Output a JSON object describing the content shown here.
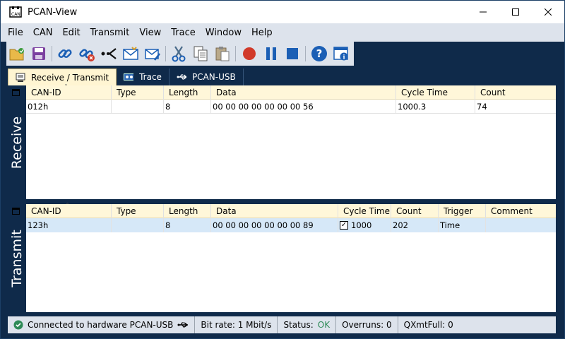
{
  "window": {
    "title": "PCAN-View"
  },
  "menu": [
    "File",
    "CAN",
    "Edit",
    "Transmit",
    "View",
    "Trace",
    "Window",
    "Help"
  ],
  "toolbar": {
    "icons": [
      "open-icon",
      "save-icon",
      "connect-icon",
      "disconnect-icon",
      "reset-icon",
      "new-message-icon",
      "edit-message-icon",
      "cut-icon",
      "copy-icon",
      "paste-icon",
      "record-icon",
      "pause-icon",
      "stop-icon",
      "help-icon",
      "about-icon"
    ]
  },
  "tabs": [
    {
      "label": "Receive / Transmit",
      "active": true
    },
    {
      "label": "Trace",
      "active": false
    },
    {
      "label": "PCAN-USB",
      "active": false
    }
  ],
  "receive": {
    "side_label": "Receive",
    "columns": [
      "CAN-ID",
      "Type",
      "Length",
      "Data",
      "Cycle Time",
      "Count"
    ],
    "rows": [
      {
        "can_id": "012h",
        "type": "",
        "length": "8",
        "data": "00 00 00 00 00 00 00 56",
        "cycle_time": "1000.3",
        "count": "74"
      }
    ]
  },
  "transmit": {
    "side_label": "Transmit",
    "columns": [
      "CAN-ID",
      "Type",
      "Length",
      "Data",
      "Cycle Time",
      "Count",
      "Trigger",
      "Comment"
    ],
    "rows": [
      {
        "can_id": "123h",
        "type": "",
        "length": "8",
        "data": "00 00 00 00 00 00 00 89",
        "cycle_checked": true,
        "cycle_time": "1000",
        "count": "202",
        "trigger": "Time",
        "comment": ""
      }
    ]
  },
  "status": {
    "connected_text": "Connected to hardware PCAN-USB",
    "bit_rate": "Bit rate: 1 Mbit/s",
    "status_label": "Status:",
    "status_value": "OK",
    "overruns": "Overruns: 0",
    "qxmtfull": "QXmtFull: 0"
  },
  "colors": {
    "accent": "#0f2a4a",
    "header_bg": "#fff7d9",
    "ok": "#2e8b57",
    "selected_row": "#d6e8f8"
  }
}
